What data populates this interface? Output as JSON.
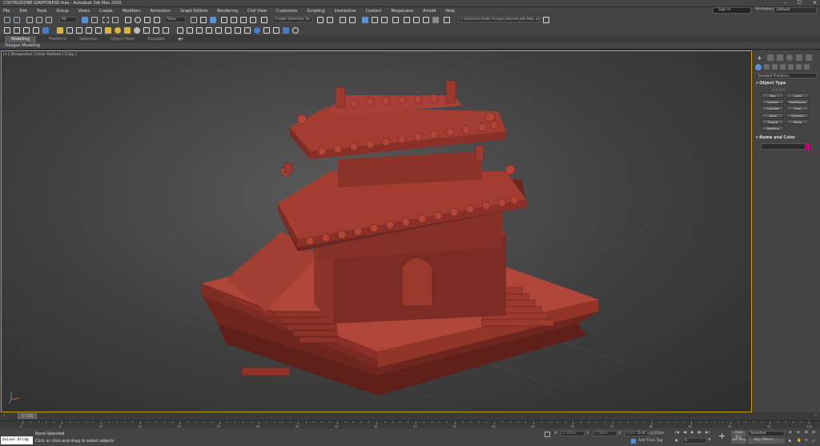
{
  "app": {
    "title": "COSTRUZIONE GIAPPONESE.max - Autodesk 3ds Max 2020"
  },
  "window_controls": [
    "–",
    "☐",
    "✕"
  ],
  "menu": [
    "File",
    "Edit",
    "Tools",
    "Group",
    "Views",
    "Create",
    "Modifiers",
    "Animation",
    "Graph Editors",
    "Rendering",
    "Civil View",
    "Customize",
    "Scripting",
    "Interactive",
    "Content",
    "Megascans",
    "Arnold",
    "Help"
  ],
  "sign_in": "Sign In",
  "workspace": {
    "label": "Workspaces:",
    "value": "Default"
  },
  "toolbar": {
    "filter": "All",
    "view": "View",
    "selection_set": "Create Selection Se",
    "project_path": "C:\\Users\\STUDIO PC\\Documents\\3ds Max 2020"
  },
  "ribbon_tabs": [
    "Modeling",
    "Freeform",
    "Selection",
    "Object Paint",
    "Populate"
  ],
  "ribbon_active": "Modeling",
  "poly_label": "Polygon Modeling",
  "viewport_label": "[+] [Perspective ] [User Defined ] [Clay ]",
  "command_panel": {
    "category": "Standard Primitives",
    "object_type_title": "Object Type",
    "autogrid": "AutoGrid",
    "buttons": [
      "Box",
      "Cone",
      "Sphere",
      "GeoSphere",
      "Cylinder",
      "Tube",
      "Torus",
      "Pyramid",
      "Teapot",
      "Plane",
      "TextPlus"
    ],
    "name_color_title": "Name and Color",
    "swatch_color": "#c8007a"
  },
  "time": {
    "slider": "0 / 100",
    "ticks": [
      "0",
      "5",
      "10",
      "15",
      "20",
      "25",
      "30",
      "35",
      "40",
      "45",
      "50",
      "55",
      "60",
      "65",
      "70",
      "75",
      "80",
      "85",
      "90",
      "95",
      "100"
    ]
  },
  "status": {
    "maxscript": "Quixel Bridg",
    "selection": "None Selected",
    "hint": "Click or click-and-drag to select objects",
    "x_label": "X:",
    "y_label": "Y:",
    "z_label": "Z:",
    "x": "1,369m",
    "y": "7,786m",
    "z": "0,0m",
    "grid": "Grid = 0,254m",
    "add_time_tag": "Add Time Tag",
    "frame": "0",
    "auto_key": "Auto Key",
    "set_key": "Set Key",
    "selected": "Selected",
    "key_filters": "Key Filters..."
  },
  "colors": {
    "object": "#9e3a30",
    "accent": "#c9a200"
  }
}
